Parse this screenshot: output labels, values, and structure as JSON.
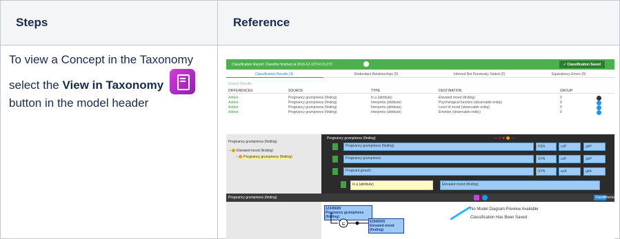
{
  "table": {
    "headers": {
      "steps": "Steps",
      "reference": "Reference"
    },
    "steps_text": {
      "line1": "To view a Concept in the Taxonomy select the",
      "bold1": "View in Taxonomy",
      "line2": "button in the model header"
    }
  },
  "screenshot": {
    "title": "Classification Report: Classifier finished at 2016-12-13T14:15:27Z",
    "saved_button": "Classification Saved",
    "tabs": [
      "Classification Results (4)",
      "Redundant Relationships (0)",
      "Inferred Not Previously Stated (0)",
      "Equivalency Errors (0)"
    ],
    "search_placeholder": "Search Results",
    "columns": [
      "DIFFERENCES",
      "SOURCE",
      "TYPE",
      "DESTINATION",
      "GROUP"
    ],
    "rows": [
      [
        "Added",
        "Pregnancy grumpiness (finding)",
        "Is a (attribute)",
        "Elevated mood (finding)",
        "0"
      ],
      [
        "Added",
        "Pregnancy grumpiness (finding)",
        "Interprets (attribute)",
        "Psychological function (observable entity)",
        "0"
      ],
      [
        "Added",
        "Pregnancy grumpiness (finding)",
        "Interprets (attribute)",
        "Level of mood (observable entity)",
        "0"
      ],
      [
        "Added",
        "Pregnancy grumpiness (finding)",
        "Interprets (attribute)",
        "Emotion (observable entity)",
        "0"
      ]
    ],
    "taxonomy": {
      "header": "Pregnancy grumpiness (finding)",
      "parent": "Elevated mood (finding)",
      "child": "Pregnancy grumpiness (finding)"
    },
    "concept": {
      "title": "Pregnancy grumpiness (finding)",
      "descriptions": [
        "Pregnancy grumpiness (finding)",
        "Pregnancy grumpiness",
        "Pregnant grouch"
      ],
      "types": [
        "FSN",
        "SYN",
        "SYN"
      ],
      "case": [
        [
          "csP",
          "gbP"
        ],
        [
          "csP",
          "gbP"
        ],
        [
          "ucA",
          "gbA"
        ]
      ],
      "attribute": "Is a (attribute)",
      "attribute_value": "Elevated mood (finding)"
    },
    "diagram": {
      "title": "Pregnancy grumpiness (finding)",
      "stated": "Stated",
      "inferred": "Inferred",
      "box1_id": "12345689",
      "box1": "Pregnancy grumpiness (finding)",
      "box2_id": "61566005",
      "box2": "Elevated mood (finding)",
      "note1": "No Model Diagram Preview Available",
      "note2": "Classification Has Been Saved"
    }
  }
}
